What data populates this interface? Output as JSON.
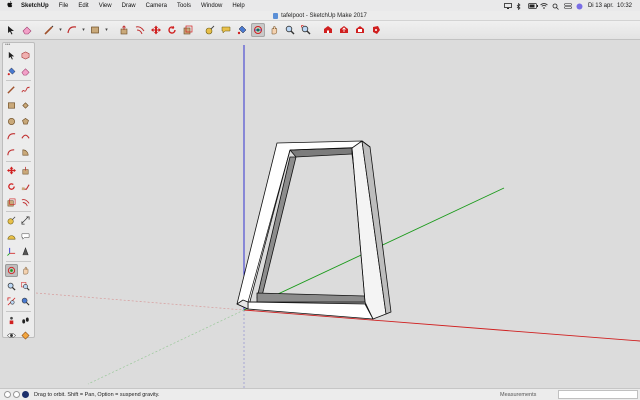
{
  "menubar": {
    "apple": "",
    "menus": [
      "SketchUp",
      "File",
      "Edit",
      "View",
      "Draw",
      "Camera",
      "Tools",
      "Window",
      "Help"
    ],
    "datetime": "Di 13 apr.  10:32"
  },
  "window": {
    "title": "tafelpoot - SketchUp Make 2017"
  },
  "toolbar": {
    "active_tool": "orbit"
  },
  "statusbar": {
    "hint": "Drag to orbit. Shift = Pan, Option = suspend gravity.",
    "measurements_label": "Measurements",
    "measurements_value": ""
  },
  "colors": {
    "red_axis": "#d02020",
    "green_axis": "#1a9a1a",
    "blue_axis": "#2020d0",
    "model_face": "#ffffff",
    "model_shade": "#8c8c8c",
    "viewport_bg": "#dcdcdc"
  }
}
